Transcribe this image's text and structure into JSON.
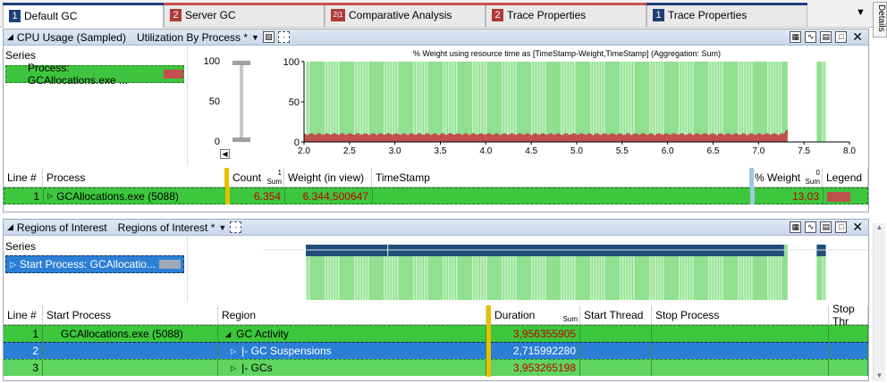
{
  "tabs": [
    {
      "num": "1",
      "label": "Default GC",
      "num_color": "#1f3f7a",
      "bar_color": "#1f3f7a",
      "active": true
    },
    {
      "num": "2",
      "label": "Server GC",
      "num_color": "#b03a3a",
      "bar_color": "#c85050",
      "active": false
    },
    {
      "num": "2|1",
      "label": "Comparative Analysis",
      "num_color": "#b03a3a",
      "bar_color": "#c85050",
      "active": false
    },
    {
      "num": "2",
      "label": "Trace Properties",
      "num_color": "#b03a3a",
      "bar_color": "#c85050",
      "active": false
    },
    {
      "num": "1",
      "label": "Trace Properties",
      "num_color": "#1f3f7a",
      "bar_color": "#1f3f7a",
      "active": false
    }
  ],
  "side_tab": "Details",
  "cpu_panel": {
    "title": "CPU Usage (Sampled)",
    "preset": "Utilization By Process *",
    "series_header": "Series",
    "series_item": "Process: GCAllocations.exe ...",
    "chart_title": "% Weight using resource time as [TimeStamp-Weight,TimeStamp] (Aggregation: Sum)",
    "table": {
      "columns": [
        "Line #",
        "Process",
        "Count",
        "Weight (in view)",
        "TimeStamp",
        "% Weight",
        "Legend"
      ],
      "sum_label": "Sum",
      "count_badge": "1",
      "pct_badge": "0",
      "row": {
        "line": "1",
        "process": "GCAllocations.exe (5088)",
        "count": "6.354",
        "weight": "6.344,500647",
        "pct": "13,03"
      }
    }
  },
  "roi_panel": {
    "title": "Regions of Interest",
    "preset": "Regions of Interest *",
    "series_header": "Series",
    "series_item": "Start Process: GCAllocatio...",
    "table": {
      "columns": [
        "Line #",
        "Start Process",
        "Region",
        "Duration",
        "Start Thread",
        "Stop Process",
        "Stop Thr"
      ],
      "sum_label": "Sum",
      "rows": [
        {
          "line": "1",
          "start_process": "GCAllocations.exe (5088)",
          "region": "GC Activity",
          "duration": "3,956355905"
        },
        {
          "line": "2",
          "start_process": "",
          "region": "|- GC Suspensions",
          "duration": "2,715992280"
        },
        {
          "line": "3",
          "start_process": "",
          "region": "|- GCs",
          "duration": "3,953265198"
        }
      ]
    }
  },
  "chart_data": {
    "type": "area",
    "title": "% Weight using resource time as [TimeStamp-Weight,TimeStamp] (Aggregation: Sum)",
    "xlim": [
      2.0,
      8.0
    ],
    "ylim": [
      0,
      100
    ],
    "x_ticks": [
      "2.0",
      "2.5",
      "3.0",
      "3.5",
      "4.0",
      "4.5",
      "5.0",
      "5.5",
      "6.0",
      "6.5",
      "7.0",
      "7.5",
      "8.0"
    ],
    "y_ticks": [
      "100",
      "50",
      "0"
    ],
    "series": [
      {
        "name": "GCAllocations.exe (5088)",
        "color": "#c0504d",
        "approx_value": 10
      }
    ],
    "highlight_ranges": [
      [
        2.02,
        7.32
      ],
      [
        7.64,
        7.74
      ]
    ],
    "colors": {
      "selection_green": "#4cd14c",
      "line_red": "#c0504d",
      "region_blue": "#1f4e79"
    }
  }
}
